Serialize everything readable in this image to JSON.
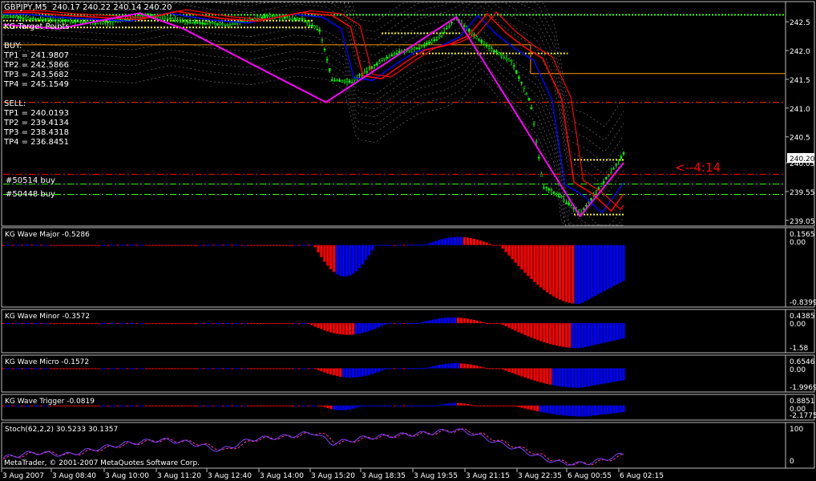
{
  "header": {
    "symbol": "GBPJPY,M5",
    "ohlc": "240.17 240.22 240.14 240.20",
    "target_label": "KG Target Points"
  },
  "theme": {
    "background": "#000000",
    "frame": "#bdbdbd",
    "candle": "#00ff00",
    "zigzag": "#ff00ff",
    "ma_red": "#ff0000",
    "ma_blue": "#0000ff",
    "envelope": "#7a7a7a",
    "level_green": "#33ff00",
    "level_orange": "#ff9900",
    "level_yellow": "#ffff00",
    "sell_line": "#ff0000",
    "stoch": "#7b3fff",
    "stoch_signal": "#ff33aa",
    "bar_red": "#ff0000",
    "bar_blue": "#0000ff"
  },
  "targets": {
    "buy_title": "BUY:",
    "buy": [
      {
        "label": "TP1",
        "value": "241.9807"
      },
      {
        "label": "TP2",
        "value": "242.5866"
      },
      {
        "label": "TP3",
        "value": "243.5682"
      },
      {
        "label": "TP4",
        "value": "245.1549"
      }
    ],
    "sell_title": "SELL:",
    "sell": [
      {
        "label": "TP1",
        "value": "240.0193"
      },
      {
        "label": "TP2",
        "value": "239.4134"
      },
      {
        "label": "TP3",
        "value": "238.4318"
      },
      {
        "label": "TP4",
        "value": "236.8451"
      }
    ]
  },
  "orders": [
    "#50514 buy",
    "#50448 buy"
  ],
  "timer_label": "<--4:14",
  "current_price": "240.20",
  "copyright": "MetaTrader, © 2001-2007 MetaQuotes Software Corp.",
  "x_axis_labels": [
    "3 Aug 2007",
    "3 Aug 08:40",
    "3 Aug 10:00",
    "3 Aug 11:20",
    "3 Aug 12:40",
    "3 Aug 14:00",
    "3 Aug 15:20",
    "3 Aug 18:35",
    "3 Aug 19:55",
    "3 Aug 21:15",
    "3 Aug 22:35",
    "6 Aug 00:55",
    "6 Aug 02:15"
  ],
  "chart_data": [
    {
      "type": "line",
      "title": "GBPJPY,M5",
      "y_ticks": [
        "242.5",
        "242.0",
        "241.5",
        "241.0",
        "240.5",
        "240.05",
        "239.55",
        "239.05"
      ],
      "ylim": [
        239.0,
        242.8
      ],
      "price_path": [
        {
          "t": 0.0,
          "v": 242.6
        },
        {
          "t": 0.05,
          "v": 242.55
        },
        {
          "t": 0.1,
          "v": 242.52
        },
        {
          "t": 0.17,
          "v": 242.48
        },
        {
          "t": 0.23,
          "v": 242.62
        },
        {
          "t": 0.3,
          "v": 242.5
        },
        {
          "t": 0.36,
          "v": 242.45
        },
        {
          "t": 0.43,
          "v": 242.6
        },
        {
          "t": 0.48,
          "v": 242.55
        },
        {
          "t": 0.51,
          "v": 242.35
        },
        {
          "t": 0.53,
          "v": 241.5
        },
        {
          "t": 0.56,
          "v": 241.45
        },
        {
          "t": 0.6,
          "v": 241.75
        },
        {
          "t": 0.63,
          "v": 241.95
        },
        {
          "t": 0.67,
          "v": 242.05
        },
        {
          "t": 0.7,
          "v": 242.2
        },
        {
          "t": 0.73,
          "v": 242.58
        },
        {
          "t": 0.76,
          "v": 242.25
        },
        {
          "t": 0.79,
          "v": 242.0
        },
        {
          "t": 0.82,
          "v": 241.8
        },
        {
          "t": 0.85,
          "v": 241.1
        },
        {
          "t": 0.87,
          "v": 239.65
        },
        {
          "t": 0.9,
          "v": 239.45
        },
        {
          "t": 0.93,
          "v": 239.15
        },
        {
          "t": 0.96,
          "v": 239.6
        },
        {
          "t": 0.98,
          "v": 239.9
        },
        {
          "t": 1.0,
          "v": 240.2
        }
      ],
      "zigzag": [
        {
          "t": 0.0,
          "v": 242.45
        },
        {
          "t": 0.09,
          "v": 242.38
        },
        {
          "t": 0.22,
          "v": 242.65
        },
        {
          "t": 0.29,
          "v": 242.38
        },
        {
          "t": 0.52,
          "v": 241.1
        },
        {
          "t": 0.73,
          "v": 242.58
        },
        {
          "t": 0.93,
          "v": 239.12
        },
        {
          "t": 1.0,
          "v": 240.05
        }
      ],
      "levels": [
        {
          "name": "TP green top",
          "v": 242.62,
          "color": "#33ff00",
          "style": "dotted",
          "t0": 0.0,
          "t1": 1.0
        },
        {
          "name": "TP green mid",
          "v": 241.1,
          "color": "#33ff00",
          "style": "dashdot",
          "t0": 0.0,
          "t1": 1.0
        },
        {
          "name": "orange",
          "v": 242.1,
          "color": "#ff9900",
          "style": "solid",
          "t0": 0.0,
          "t1": 0.85
        },
        {
          "name": "orange step",
          "v": 241.6,
          "color": "#ff9900",
          "style": "solid",
          "t0": 0.85,
          "t1": 1.0
        },
        {
          "name": "sell red",
          "v": 241.1,
          "color": "#ff0000",
          "style": "dashdot",
          "t0": 0.0,
          "t1": 1.0
        },
        {
          "name": "sell red low",
          "v": 239.85,
          "color": "#ff0000",
          "style": "dashdot",
          "t0": 0.0,
          "t1": 1.0
        },
        {
          "name": "green low 1",
          "v": 239.68,
          "color": "#33ff00",
          "style": "dashdot",
          "t0": 0.0,
          "t1": 1.0
        },
        {
          "name": "green low 2",
          "v": 239.5,
          "color": "#33ff00",
          "style": "dashdot",
          "t0": 0.0,
          "t1": 1.0
        }
      ]
    },
    {
      "type": "bar",
      "title": "KG Wave Major",
      "current": "-0.5286",
      "y_ticks": [
        "0.1565",
        "0.00",
        "-0.8399"
      ],
      "ylim": [
        -0.8399,
        0.1565
      ]
    },
    {
      "type": "bar",
      "title": "KG Wave Minor",
      "current": "-0.3572",
      "y_ticks": [
        "0.4385",
        "0.00",
        "-1.58"
      ],
      "ylim": [
        -1.58,
        0.4385
      ]
    },
    {
      "type": "bar",
      "title": "KG Wave Micro",
      "current": "-0.1572",
      "y_ticks": [
        "0.6546",
        "0.00",
        "-1.9969"
      ],
      "ylim": [
        -1.9969,
        0.6546
      ]
    },
    {
      "type": "bar",
      "title": "KG Wave Trigger",
      "current": "-0.0819",
      "y_ticks": [
        "0.8851",
        "0.00",
        "-2.1775"
      ],
      "ylim": [
        -2.1775,
        0.8851
      ]
    },
    {
      "type": "line",
      "title": "Stoch(62,2,2)",
      "values_text": "30.5233 30.1357",
      "y_ticks": [
        "100",
        "0"
      ],
      "ylim": [
        0,
        100
      ]
    }
  ]
}
